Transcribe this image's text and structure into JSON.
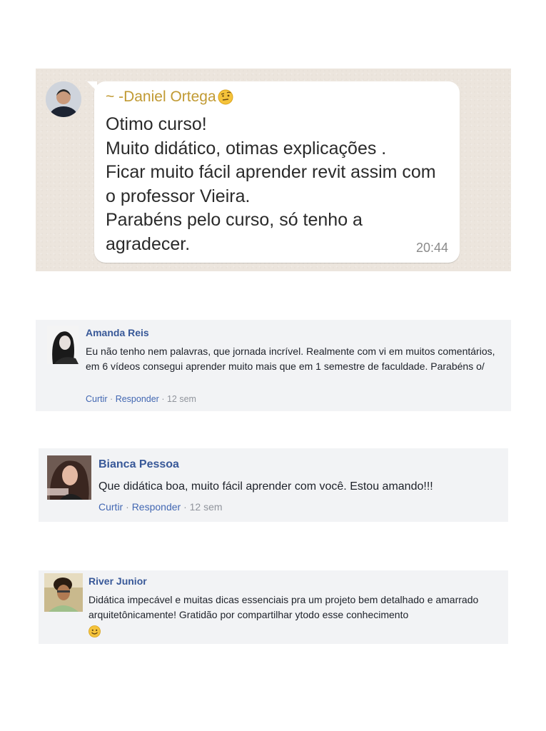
{
  "whatsapp": {
    "sender": "~ -Daniel Ortega",
    "sender_emoji": "raised-eyebrow-emoji",
    "message": "Otimo curso!\nMuito didático, otimas explicações .\nFicar muito fácil aprender revit assim com o professor Vieira.\nParabéns pelo curso, só tenho a agradecer.",
    "time": "20:44"
  },
  "comments": [
    {
      "name": "Amanda Reis",
      "text": "Eu não tenho nem palavras, que jornada incrível. Realmente com vi em muitos comentários, em 6 vídeos consegui aprender muito mais que em 1 semestre de faculdade. Parabéns o/",
      "like": "Curtir",
      "reply": "Responder",
      "time": "12 sem"
    },
    {
      "name": "Bianca Pessoa",
      "text": "Que didática boa, muito fácil aprender com você. Estou amando!!!",
      "like": "Curtir",
      "reply": "Responder",
      "time": "12 sem"
    },
    {
      "name": "River Junior",
      "text": "Didática impecável e muitas dicas essenciais pra um projeto bem detalhado e amarrado arquitetônicamente! Gratidão por compartilhar ytodo esse conhecimento",
      "emoji": "smile-emoji"
    }
  ],
  "colors": {
    "wa_background": "#ece5dd",
    "wa_sender": "#c19a33",
    "fb_name": "#385898",
    "fb_link": "#4267b2",
    "fb_meta": "#90949c",
    "fb_card": "#f2f3f5"
  }
}
